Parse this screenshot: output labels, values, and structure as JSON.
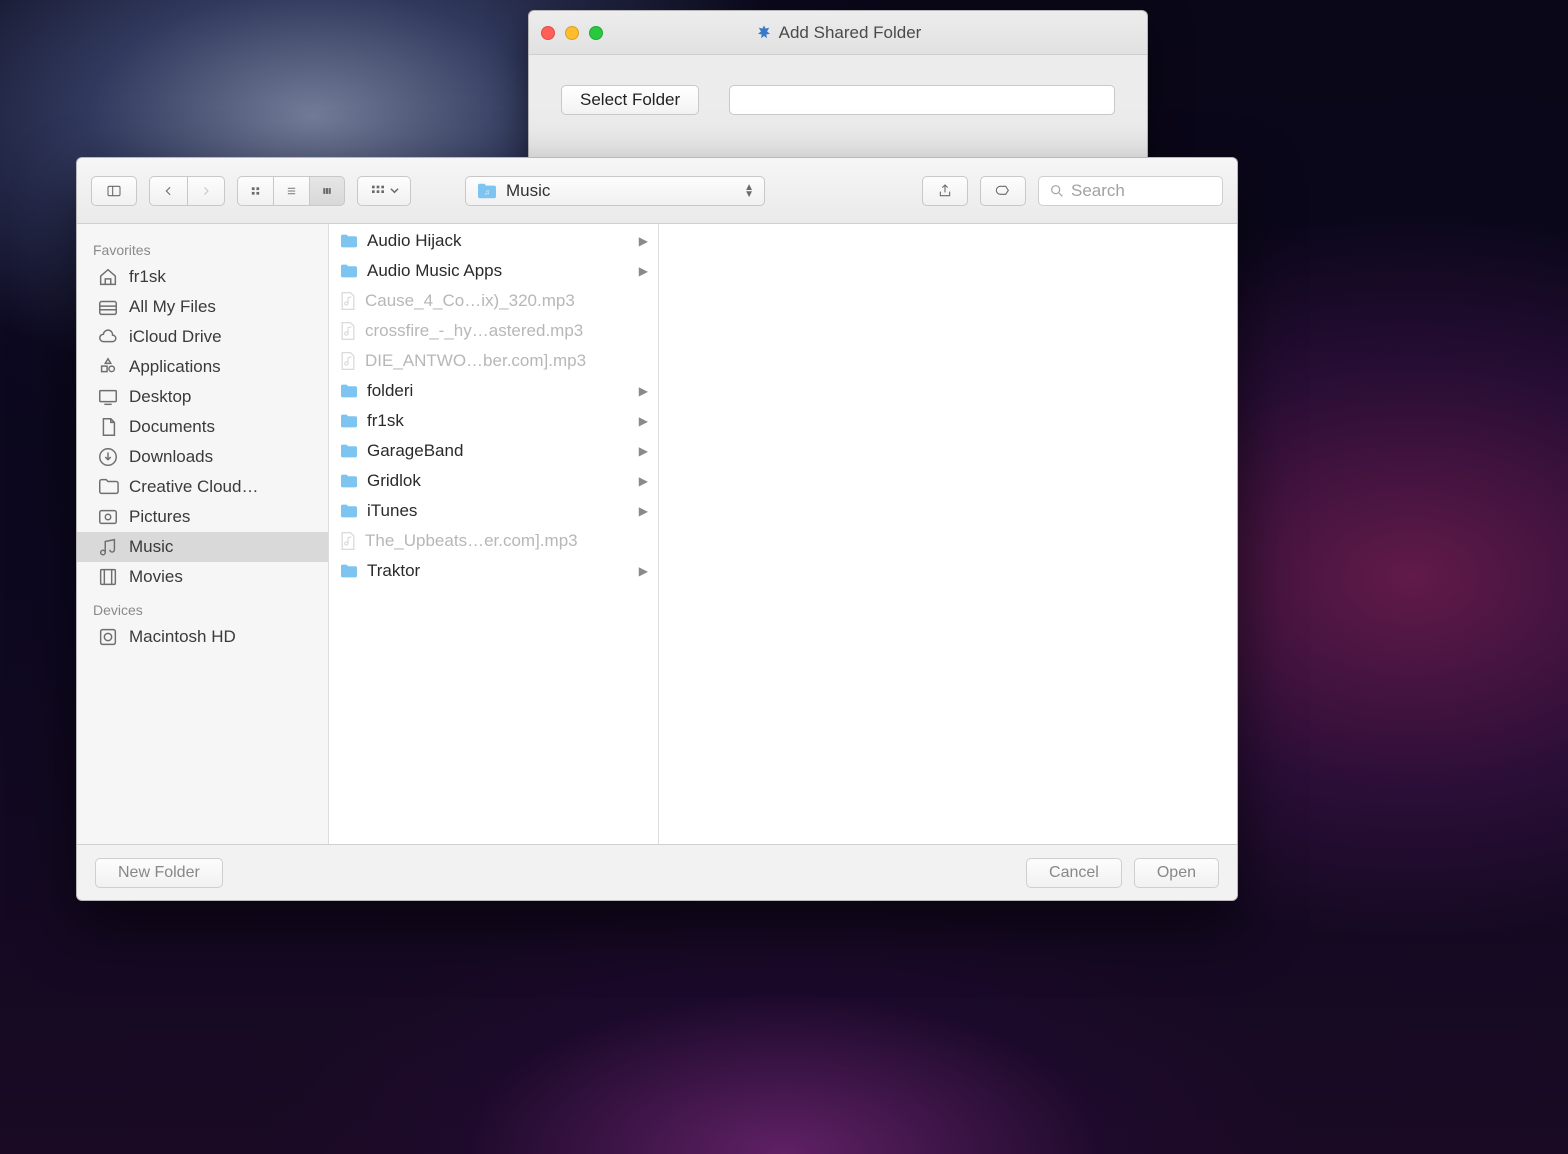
{
  "parent": {
    "title": "Add Shared Folder",
    "select_button": "Select Folder",
    "input_value": ""
  },
  "toolbar": {
    "path_label": "Music",
    "search_placeholder": "Search"
  },
  "sidebar": {
    "favorites_header": "Favorites",
    "devices_header": "Devices",
    "favorites": [
      {
        "icon": "home",
        "label": "fr1sk"
      },
      {
        "icon": "allmyfiles",
        "label": "All My Files"
      },
      {
        "icon": "icloud",
        "label": "iCloud Drive"
      },
      {
        "icon": "apps",
        "label": "Applications"
      },
      {
        "icon": "desktop",
        "label": "Desktop"
      },
      {
        "icon": "doc",
        "label": "Documents"
      },
      {
        "icon": "download",
        "label": "Downloads"
      },
      {
        "icon": "folder",
        "label": "Creative Cloud…"
      },
      {
        "icon": "pictures",
        "label": "Pictures"
      },
      {
        "icon": "music",
        "label": "Music",
        "selected": true
      },
      {
        "icon": "movies",
        "label": "Movies"
      }
    ],
    "devices": [
      {
        "icon": "disk",
        "label": "Macintosh HD"
      }
    ]
  },
  "column_items": [
    {
      "type": "folder",
      "name": "Audio Hijack"
    },
    {
      "type": "folder",
      "name": "Audio Music Apps"
    },
    {
      "type": "file",
      "name": "Cause_4_Co…ix)_320.mp3"
    },
    {
      "type": "file",
      "name": "crossfire_-_hy…astered.mp3"
    },
    {
      "type": "file",
      "name": "DIE_ANTWO…ber.com].mp3"
    },
    {
      "type": "folder",
      "name": "folderi"
    },
    {
      "type": "folder",
      "name": "fr1sk"
    },
    {
      "type": "folder",
      "name": "GarageBand"
    },
    {
      "type": "folder",
      "name": "Gridlok"
    },
    {
      "type": "folder",
      "name": "iTunes"
    },
    {
      "type": "file",
      "name": "The_Upbeats…er.com].mp3"
    },
    {
      "type": "folder",
      "name": "Traktor"
    }
  ],
  "bottom": {
    "new_folder": "New Folder",
    "cancel": "Cancel",
    "open": "Open"
  }
}
